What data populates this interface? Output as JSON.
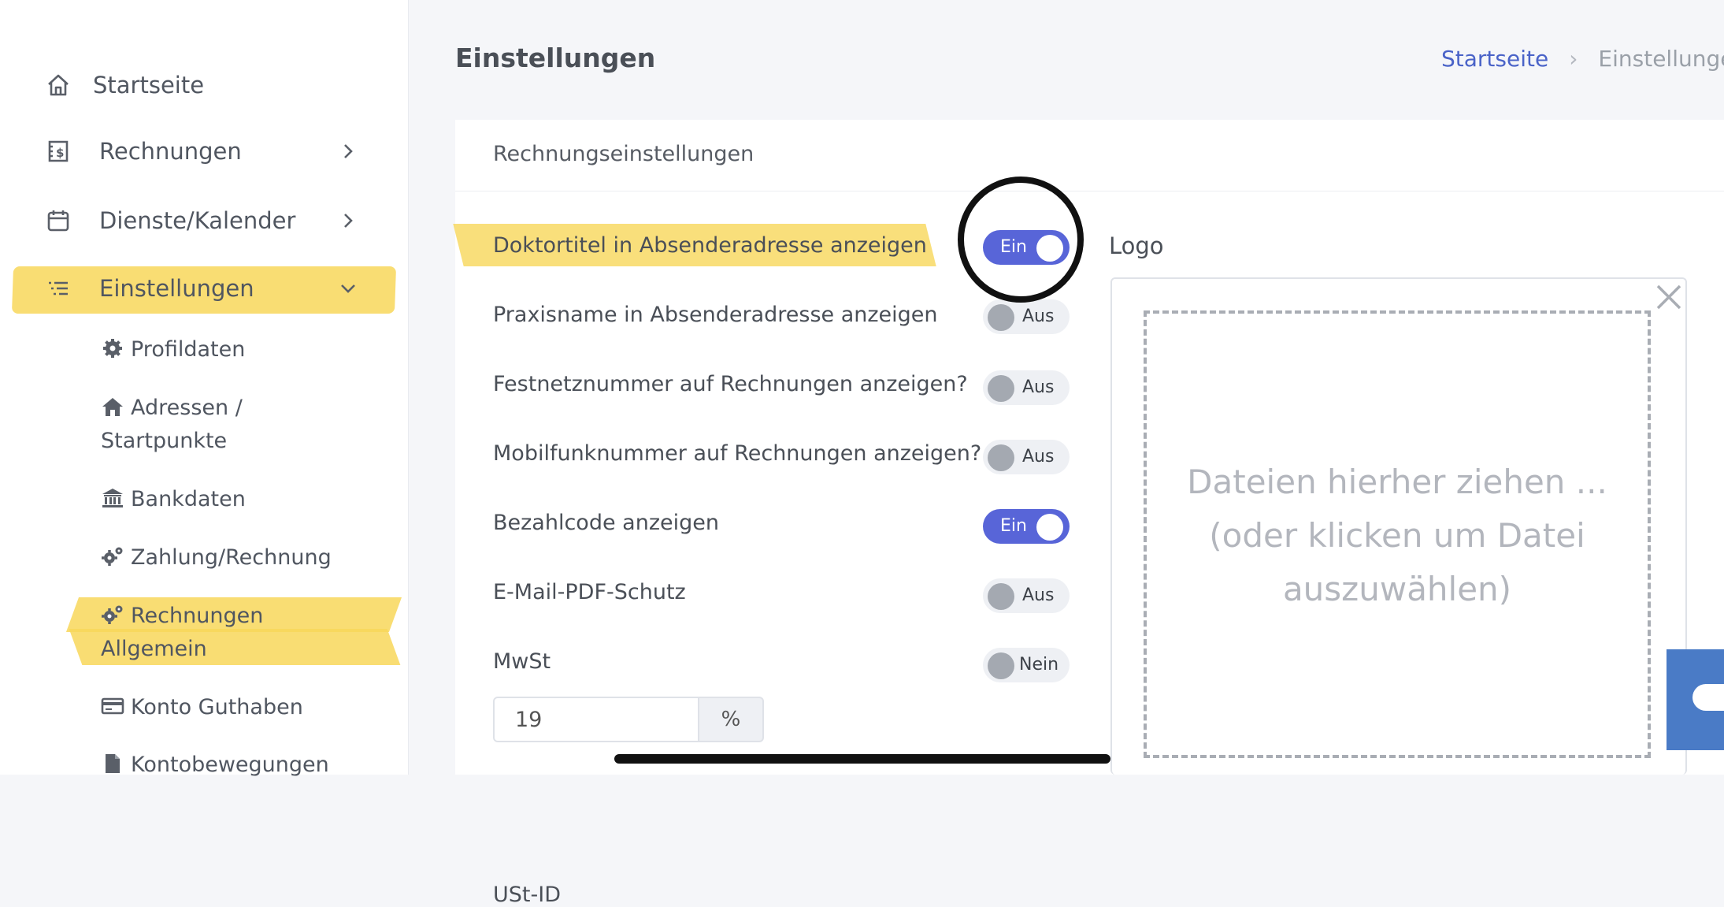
{
  "sidebar": {
    "items": [
      {
        "label": "Startseite",
        "icon": "home-icon"
      },
      {
        "label": "Rechnungen",
        "icon": "invoice-icon"
      },
      {
        "label": "Dienste/Kalender",
        "icon": "calendar-icon"
      },
      {
        "label": "Einstellungen",
        "icon": "list-icon"
      }
    ],
    "subitems": [
      {
        "label": "Profildaten",
        "icon": "gear-icon"
      },
      {
        "label_line1": "Adressen /",
        "label_line2": "Startpunkte",
        "icon": "house-icon"
      },
      {
        "label": "Bankdaten",
        "icon": "bank-icon"
      },
      {
        "label": "Zahlung/Rechnung",
        "icon": "gears-icon"
      },
      {
        "label_line1": "Rechnungen",
        "label_line2": "Allgemein",
        "icon": "gears-icon"
      },
      {
        "label": "Konto Guthaben",
        "icon": "credit-card-icon"
      },
      {
        "label": "Kontobewegungen",
        "icon": "file-icon"
      }
    ]
  },
  "header": {
    "title": "Einstellungen",
    "breadcrumb": {
      "home": "Startseite",
      "separator": "›",
      "current": "Einstellungen"
    }
  },
  "card": {
    "title": "Rechnungseinstellungen",
    "settings": [
      {
        "label": "Doktortitel in Absenderadresse anzeigen",
        "state": "Ein"
      },
      {
        "label": "Praxisname in Absenderadresse anzeigen",
        "state": "Aus"
      },
      {
        "label": "Festnetznummer auf Rechnungen anzeigen?",
        "state": "Aus"
      },
      {
        "label": "Mobilfunknummer auf Rechnungen anzeigen?",
        "state": "Aus"
      },
      {
        "label": "Bezahlcode anzeigen",
        "state": "Ein"
      },
      {
        "label": "E-Mail-PDF-Schutz",
        "state": "Aus"
      },
      {
        "label": "MwSt",
        "state": "Nein"
      }
    ],
    "vat": {
      "value": "19",
      "unit": "%"
    },
    "cut_label": "USt-ID"
  },
  "logo": {
    "label": "Logo",
    "dropzone_line1": "Dateien hierher ziehen ...",
    "dropzone_line2": "(oder klicken um Datei",
    "dropzone_line3": "auszuwählen)"
  },
  "colors": {
    "accent": "#5865d8",
    "link": "#4a63c8",
    "highlight": "#f8d75a"
  }
}
